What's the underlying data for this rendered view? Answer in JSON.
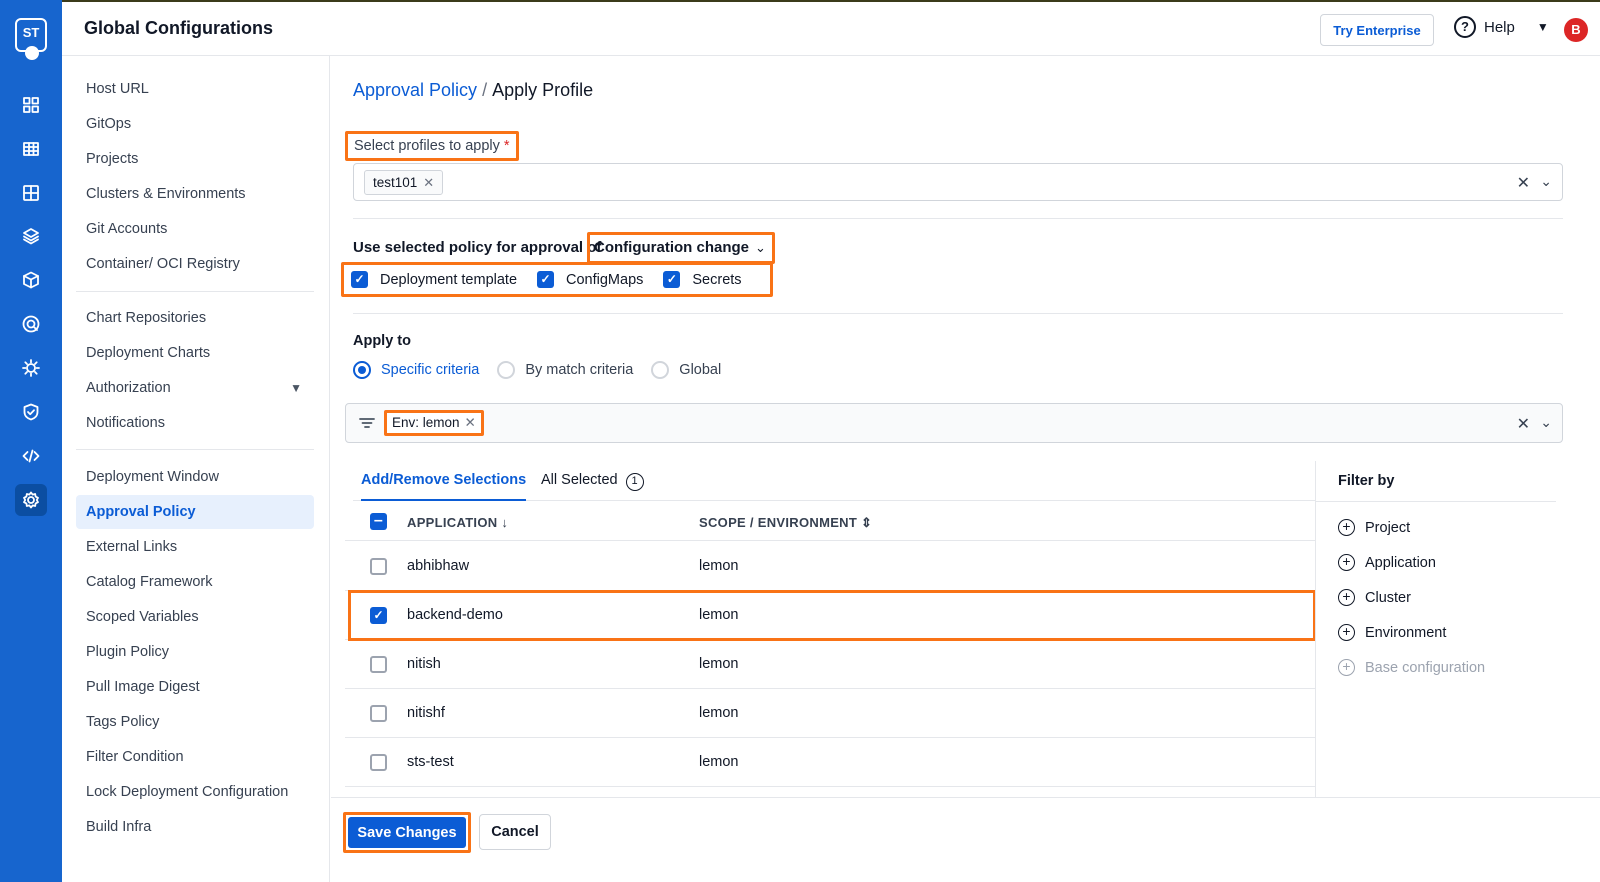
{
  "app": {
    "logo_text": "ST",
    "title": "Global Configurations"
  },
  "header": {
    "try_enterprise": "Try Enterprise",
    "help_label": "Help",
    "avatar_initial": "B"
  },
  "rail_icons": [
    "grid-icon",
    "table-icon",
    "apps-icon",
    "layers-icon",
    "cube-icon",
    "target-icon",
    "gear-bug-icon",
    "shield-check-icon",
    "code-icon",
    "settings-icon"
  ],
  "nav": {
    "group1": [
      "Host URL",
      "GitOps",
      "Projects",
      "Clusters & Environments",
      "Git Accounts",
      "Container/ OCI Registry"
    ],
    "group2": [
      "Chart Repositories",
      "Deployment Charts",
      "Authorization",
      "Notifications"
    ],
    "group3": [
      "Deployment Window",
      "Approval Policy",
      "External Links",
      "Catalog Framework",
      "Scoped Variables",
      "Plugin Policy",
      "Pull Image Digest",
      "Tags Policy",
      "Filter Condition",
      "Lock Deployment Configuration",
      "Build Infra"
    ],
    "active": "Approval Policy"
  },
  "breadcrumb": {
    "parent": "Approval Policy",
    "separator": "/",
    "current": "Apply Profile"
  },
  "profiles": {
    "label": "Select profiles to apply",
    "required_mark": "*",
    "chips": [
      "test101"
    ]
  },
  "policy": {
    "prefix": "Use selected policy for approval of",
    "selected": "Configuration change",
    "checkboxes": [
      {
        "label": "Deployment template",
        "checked": true
      },
      {
        "label": "ConfigMaps",
        "checked": true
      },
      {
        "label": "Secrets",
        "checked": true
      }
    ]
  },
  "apply_to": {
    "label": "Apply to",
    "options": [
      "Specific criteria",
      "By match criteria",
      "Global"
    ],
    "selected": "Specific criteria"
  },
  "filter": {
    "chip": "Env: lemon"
  },
  "tabs": {
    "add_remove": "Add/Remove Selections",
    "all_selected": "All Selected",
    "all_selected_count": "1"
  },
  "table": {
    "headers": {
      "application": "APPLICATION ↓",
      "scope": "SCOPE / ENVIRONMENT ⇕"
    },
    "rows": [
      {
        "app": "abhibhaw",
        "env": "lemon",
        "checked": false
      },
      {
        "app": "backend-demo",
        "env": "lemon",
        "checked": true
      },
      {
        "app": "nitish",
        "env": "lemon",
        "checked": false
      },
      {
        "app": "nitishf",
        "env": "lemon",
        "checked": false
      },
      {
        "app": "sts-test",
        "env": "lemon",
        "checked": false
      }
    ]
  },
  "filter_by": {
    "title": "Filter by",
    "items": [
      "Project",
      "Application",
      "Cluster",
      "Environment"
    ],
    "disabled_item": "Base configuration"
  },
  "footer": {
    "save": "Save Changes",
    "cancel": "Cancel"
  },
  "colors": {
    "rail": "#1765ce",
    "accent": "#0b5cd5",
    "highlight": "#f97316",
    "required": "#dc2626"
  }
}
